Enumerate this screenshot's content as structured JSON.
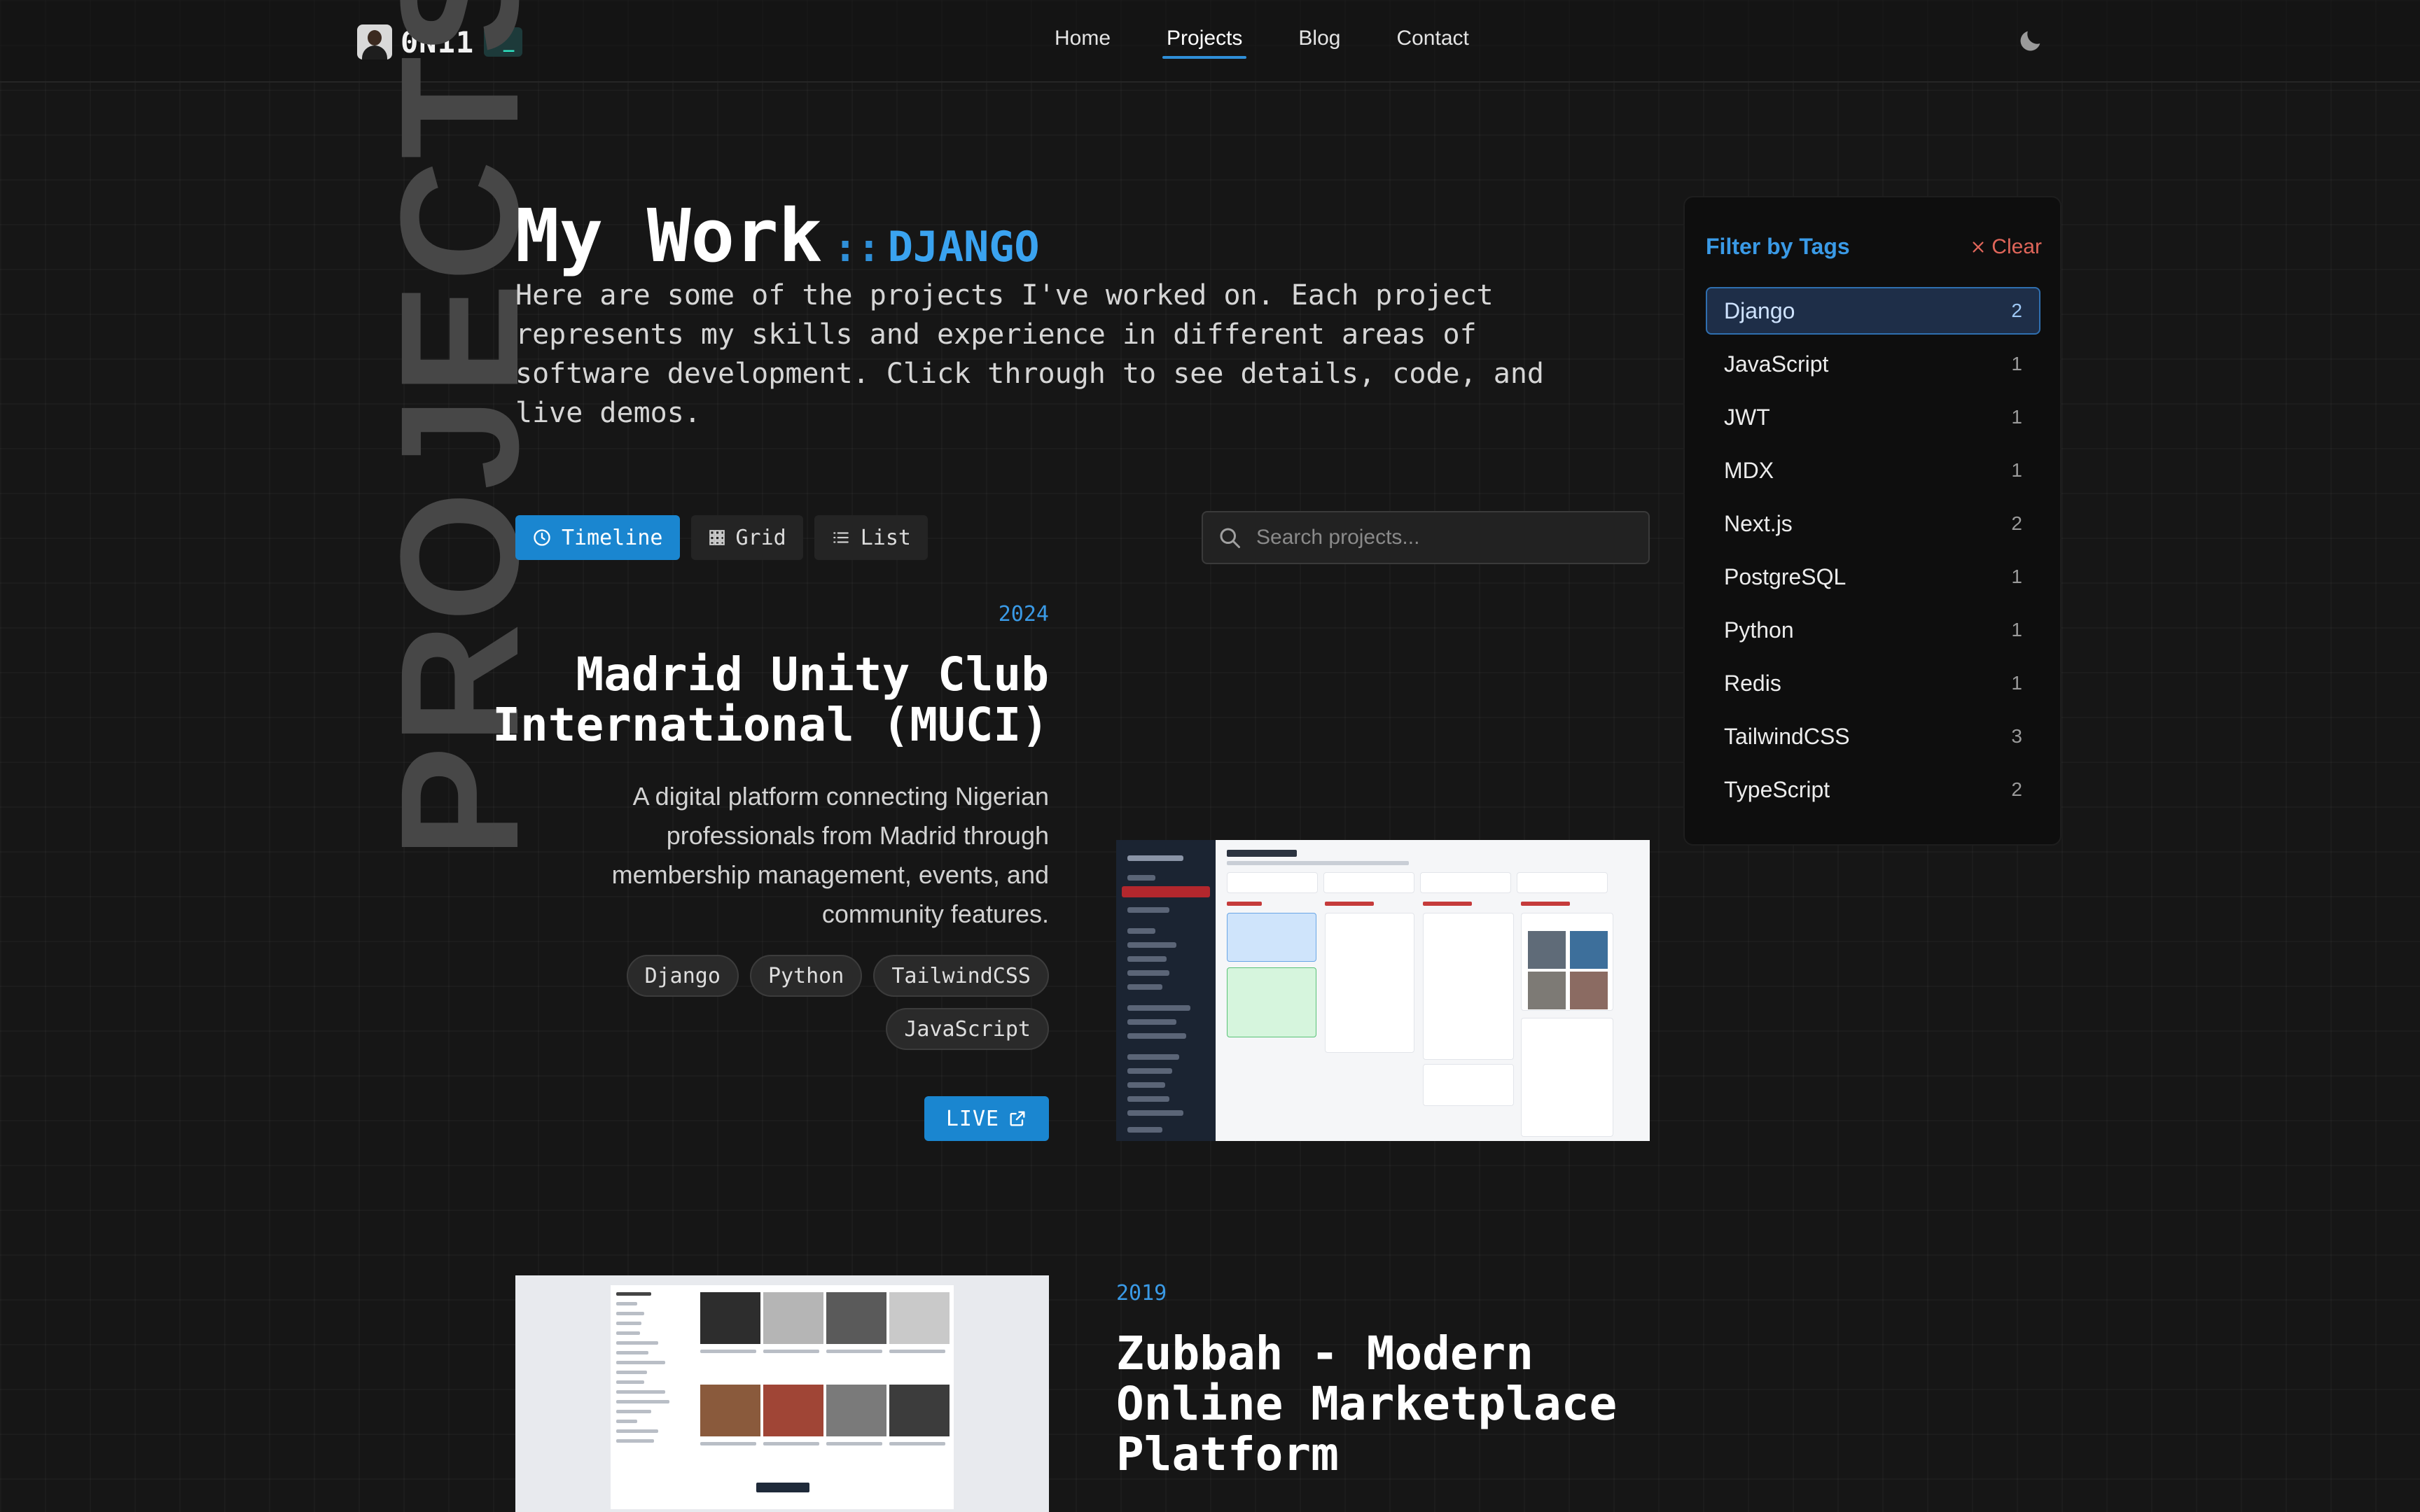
{
  "brand": {
    "name": "0N11",
    "prompt": ">_"
  },
  "nav": {
    "links": [
      "Home",
      "Projects",
      "Blog",
      "Contact"
    ],
    "active": "Projects"
  },
  "page": {
    "vertical_label": "PROJECTS",
    "title": "My Work",
    "separator": "::",
    "active_filter": "DJANGO",
    "intro": "Here are some of the projects I've worked on. Each project represents my skills and experience in different areas of software development. Click through to see details, code, and live demos."
  },
  "views": {
    "timeline": "Timeline",
    "grid": "Grid",
    "list": "List"
  },
  "search": {
    "placeholder": "Search projects..."
  },
  "filter": {
    "title": "Filter by Tags",
    "clear": "Clear",
    "tags": [
      {
        "name": "Django",
        "count": "2",
        "active": true
      },
      {
        "name": "JavaScript",
        "count": "1"
      },
      {
        "name": "JWT",
        "count": "1"
      },
      {
        "name": "MDX",
        "count": "1"
      },
      {
        "name": "Next.js",
        "count": "2"
      },
      {
        "name": "PostgreSQL",
        "count": "1"
      },
      {
        "name": "Python",
        "count": "1"
      },
      {
        "name": "Redis",
        "count": "1"
      },
      {
        "name": "TailwindCSS",
        "count": "3"
      },
      {
        "name": "TypeScript",
        "count": "2"
      }
    ]
  },
  "projects": [
    {
      "year": "2024",
      "title": "Madrid Unity Club International (MUCI)",
      "description": "A digital platform connecting Nigerian professionals from Madrid through membership management, events, and community features.",
      "tags": [
        "Django",
        "Python",
        "TailwindCSS",
        "JavaScript"
      ],
      "live_label": "LIVE"
    },
    {
      "year": "2019",
      "title": "Zubbah - Modern Online Marketplace Platform"
    }
  ],
  "colors": {
    "accent": "#1a86d0",
    "accent_text": "#3a9ae6",
    "clear": "#e0665a",
    "background": "#161616"
  }
}
